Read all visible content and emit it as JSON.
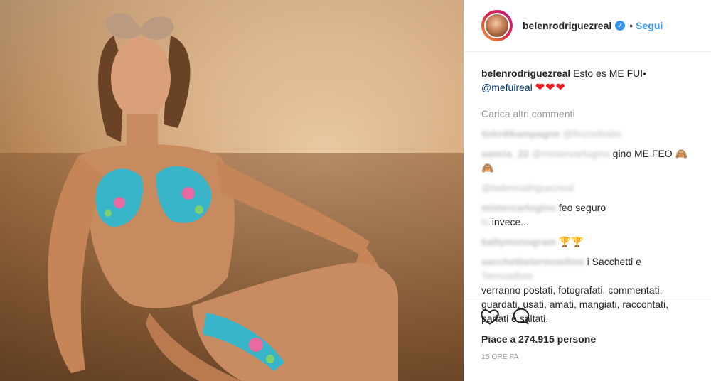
{
  "post": {
    "username": "belenrodriguezreal",
    "follow_label": "Segui",
    "separator": "•",
    "verified_mark": "✓",
    "caption": {
      "username": "belenrodriguezreal",
      "text": "Esto es ME FUI•",
      "mention": "@mefuireal",
      "hearts": "❤❤❤"
    },
    "load_more": "Carica altri commenti",
    "comments": [
      {
        "user": "tizkrdikampagne",
        "text": "@finzisdiiatio",
        "blurred": true
      },
      {
        "user": "sancis_22",
        "text": "@mistercarlogino ME FEO 🙈🙈",
        "mention": "@misterearlogino",
        "visible_text": "gino ME FEO 🙈🙈"
      },
      {
        "user": "",
        "text": "@belenrodriguezreal",
        "blurred": true
      },
      {
        "user": "mistercarlogino",
        "text": "@sancis_22 bu feo seguro",
        "visible_text": "feo seguro"
      },
      {
        "user": "",
        "text": "lo invece...",
        "visible_text": "invece..."
      },
      {
        "user": "baltymonogram",
        "text": "🏆🏆",
        "visible_text": "🏆🏆"
      },
      {
        "user": "sacchettietermosifoni",
        "text": "i Sacchetti e",
        "visible_text": "i Sacchetti e"
      },
      {
        "user": "",
        "text": "Termosifoni",
        "blurred": true
      },
      {
        "user": "",
        "text": "verranno postati, fotografati, commentati, guardati, usati, amati, mangiati, raccontati, parlati e saltati.",
        "visible_text": "verranno postati, fotografati, commentati, guardati, usati, amati, mangiati, raccontati, parlati e saltati."
      }
    ],
    "likes": "Piace a 274.915 persone",
    "timestamp": "15 ORE FA",
    "icons": {
      "like": "heart-icon",
      "comment": "comment-bubble-icon"
    },
    "colors": {
      "accent": "#3897f0",
      "heart": "#ed1c24",
      "muted": "#999999"
    }
  }
}
